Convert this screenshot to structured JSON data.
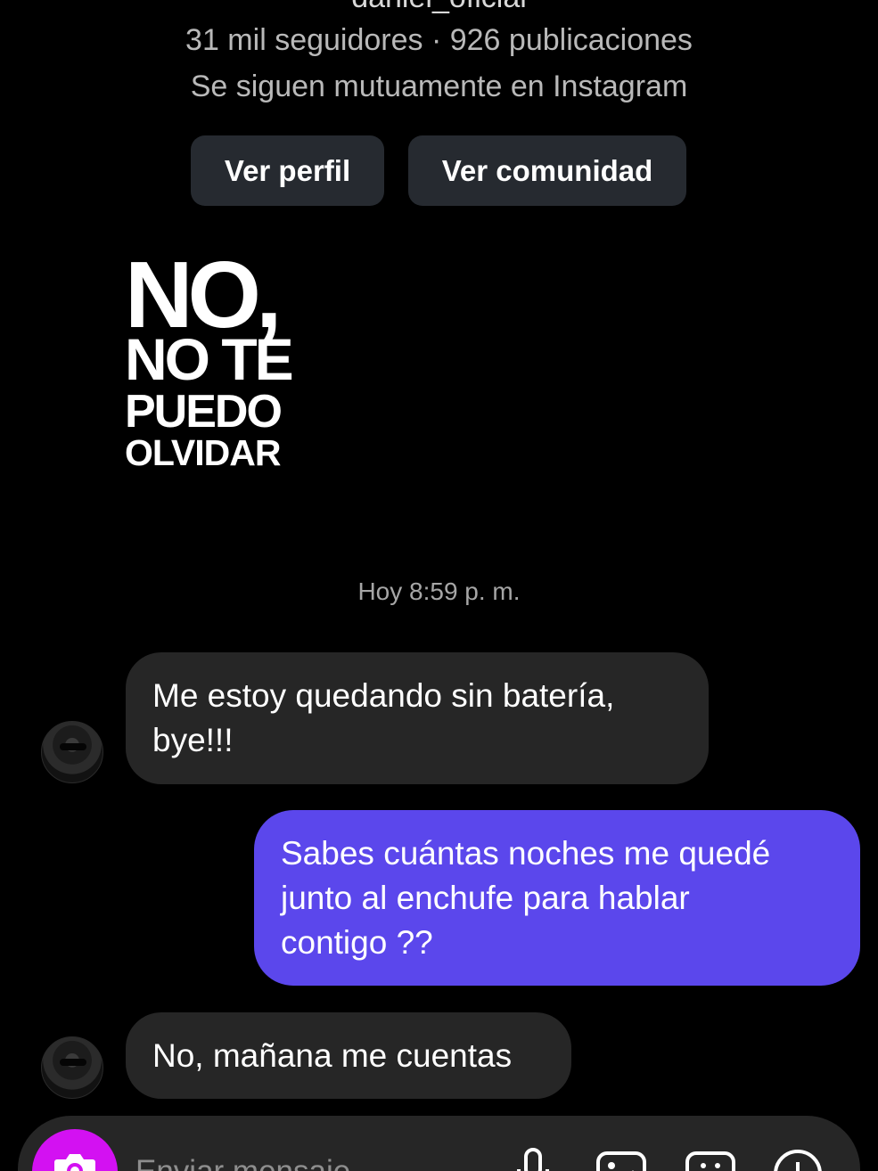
{
  "profile": {
    "username": "daniel_oficial",
    "stats": "31 mil seguidores · 926 publicaciones",
    "mutual": "Se siguen mutuamente en Instagram"
  },
  "actions": {
    "view_profile": "Ver perfil",
    "view_community": "Ver comunidad"
  },
  "shared_image": {
    "line1": "NO,",
    "line2": "NO TE",
    "line3": "PUEDO",
    "line4": "OLVIDAR"
  },
  "timestamp": "Hoy 8:59 p. m.",
  "messages": [
    {
      "direction": "incoming",
      "lines": [
        "Me estoy quedando sin batería,",
        "bye!!!"
      ]
    },
    {
      "direction": "outgoing",
      "lines": [
        "Sabes cuántas noches me quedé",
        "junto al enchufe para hablar",
        "contigo ??"
      ]
    },
    {
      "direction": "incoming",
      "lines": [
        "No, mañana me cuentas"
      ]
    }
  ],
  "composer": {
    "placeholder": "Enviar mensaje..."
  },
  "colors": {
    "background": "#000000",
    "incoming_bubble": "#262626",
    "outgoing_bubble": "#5b47ec",
    "camera_button": "#d311f2",
    "profile_button": "#262a30"
  },
  "icons": [
    "camera-icon",
    "microphone-icon",
    "gallery-icon",
    "sticker-icon",
    "plus-icon"
  ]
}
